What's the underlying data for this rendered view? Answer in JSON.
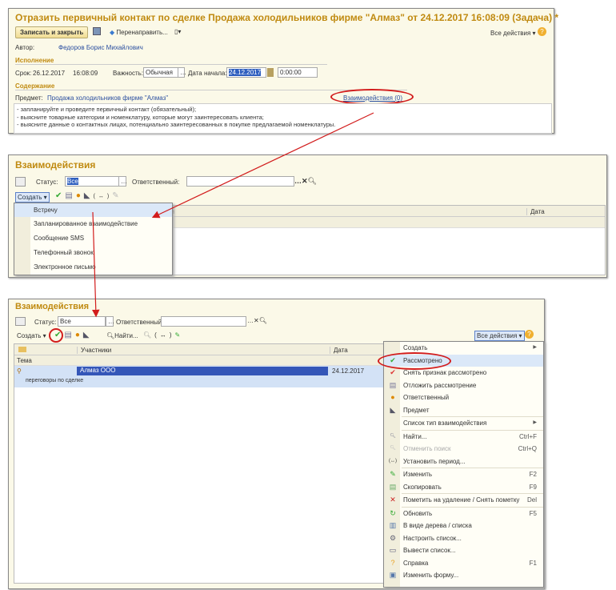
{
  "task_form": {
    "title": "Отразить первичный контакт по сделке Продажа холодильников фирме \"Алмаз\" от 24.12.2017 16:08:09 (Задача) *",
    "save_close": "Записать и закрыть",
    "redirect": "Перенаправить...",
    "all_actions": "Все действия ▾",
    "author_label": "Автор:",
    "author": "Федоров Борис Михайлович",
    "execution": "Исполнение",
    "deadline_label": "Срок:",
    "deadline_date": "26.12.2017",
    "deadline_time": "16:08:09",
    "importance_label": "Важность:",
    "importance": "Обычная",
    "start_label": "Дата начала:",
    "start_date": "24.12.2017",
    "start_time": "0:00:00",
    "content": "Содержание",
    "subject_label": "Предмет:",
    "subject": "Продажа холодильников фирме \"Алмаз\"",
    "interactions_link": "Взаимодействия (0)",
    "text": [
      "- запланируйте и проведите первичный контакт (обязательный);",
      "- выясните товарные категории и номенклатуру, которые могут заинтересовать клиента;",
      "- выясните данные о контактных лицах, потенциально заинтересованных в покупке предлагаемой номенклатуры."
    ]
  },
  "list1": {
    "title": "Взаимодействия",
    "status_label": "Статус:",
    "status": "Все",
    "resp_label": "Ответственный:",
    "create": "Создать ▾",
    "col_participants": "ки",
    "col_date": "Дата",
    "create_menu": [
      "Встречу",
      "Запланированное взаимодействие",
      "Сообщение SMS",
      "Телефонный звонок",
      "Электронное письмо"
    ]
  },
  "list2": {
    "title": "Взаимодействия",
    "status_label": "Статус:",
    "status": "Все",
    "resp_label": "Ответственный:",
    "create": "Создать ▾",
    "find": "Найти...",
    "all_actions": "Все действия ▾",
    "col_participants": "Участники",
    "col_date": "Дата",
    "col_topic": "Тема",
    "row": {
      "participants": "Алмаз ООО",
      "date": "24.12.2017",
      "topic": "переговоры по сделке"
    },
    "context_menu": [
      {
        "label": "Создать",
        "icon": "none",
        "submenu": true
      },
      {
        "label": "Рассмотрено",
        "icon": "check-green",
        "hl": true
      },
      {
        "label": "Снять признак рассмотрено",
        "icon": "check-red"
      },
      {
        "label": "Отложить рассмотрение",
        "icon": "document"
      },
      {
        "label": "Ответственный",
        "icon": "user"
      },
      {
        "label": "Предмет",
        "icon": "subject",
        "sep_after": true
      },
      {
        "label": "Список тип взаимодействия",
        "icon": "none",
        "submenu": true,
        "sep_after": true
      },
      {
        "label": "Найти...",
        "icon": "search",
        "shortcut": "Ctrl+F"
      },
      {
        "label": "Отменить поиск",
        "icon": "search-cancel",
        "shortcut": "Ctrl+Q",
        "disabled": true
      },
      {
        "label": "Установить период...",
        "icon": "period",
        "sep_after": true
      },
      {
        "label": "Изменить",
        "icon": "pencil",
        "shortcut": "F2"
      },
      {
        "label": "Скопировать",
        "icon": "copy",
        "shortcut": "F9",
        "sep_after": true
      },
      {
        "label": "Пометить на удаление / Снять пометку",
        "icon": "delete",
        "shortcut": "Del",
        "sep_after": true
      },
      {
        "label": "Обновить",
        "icon": "refresh",
        "shortcut": "F5"
      },
      {
        "label": "В виде дерева / списка",
        "icon": "tree"
      },
      {
        "label": "Настроить список...",
        "icon": "settings"
      },
      {
        "label": "Вывести список...",
        "icon": "print"
      },
      {
        "label": "Справка",
        "icon": "help",
        "shortcut": "F1"
      },
      {
        "label": "Изменить форму...",
        "icon": "form"
      }
    ]
  },
  "colors": {
    "accent": "#c08a10",
    "annotation": "#d21c1c",
    "selection": "#2f5fbf"
  }
}
